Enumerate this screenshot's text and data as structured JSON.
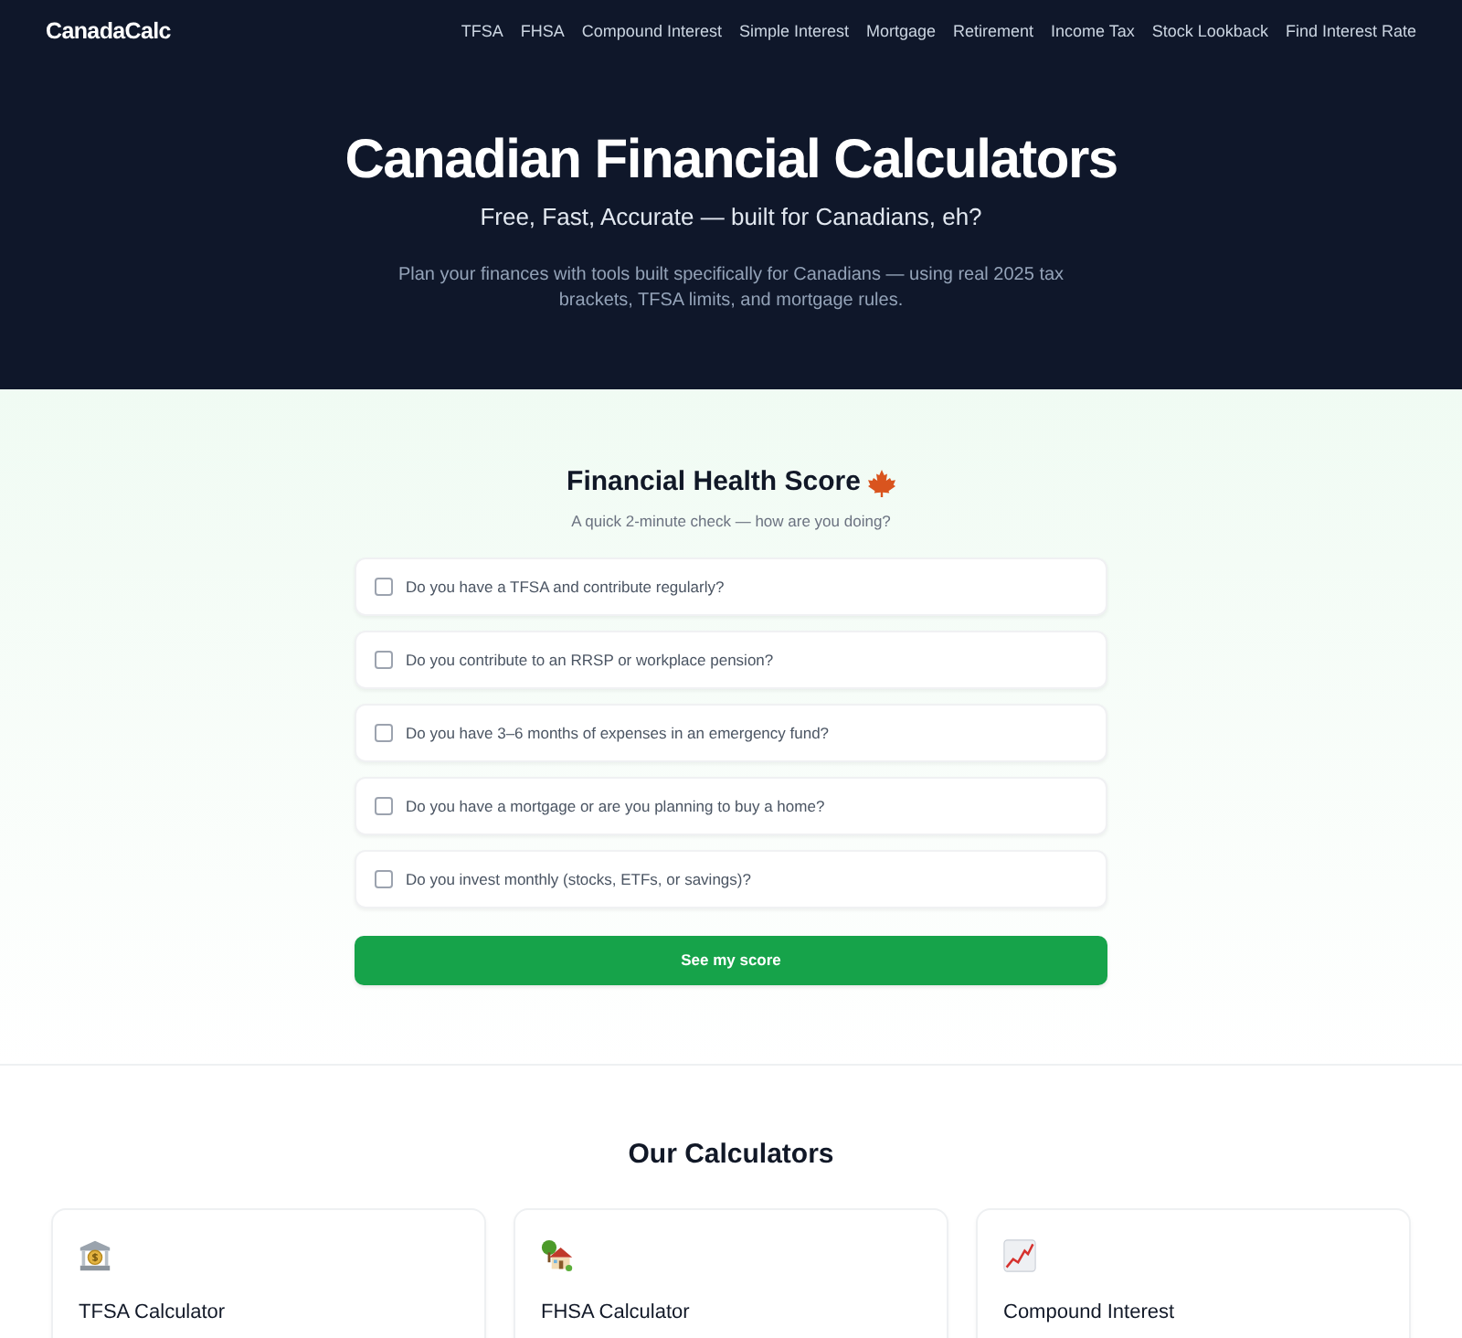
{
  "nav": {
    "logo": "CanadaCalc",
    "links": [
      "TFSA",
      "FHSA",
      "Compound Interest",
      "Simple Interest",
      "Mortgage",
      "Retirement",
      "Income Tax",
      "Stock Lookback",
      "Find Interest Rate"
    ]
  },
  "hero": {
    "title": "Canadian Financial Calculators",
    "tagline": "Free, Fast, Accurate — built for Canadians, eh?",
    "description": "Plan your finances with tools built specifically for Canadians — using real 2025 tax brackets, TFSA limits, and mortgage rules."
  },
  "quiz": {
    "title": "Financial Health Score",
    "subtitle": "A quick 2-minute check — how are you doing?",
    "questions": [
      {
        "text": "Do you have a TFSA and contribute regularly?",
        "checked": false
      },
      {
        "text": "Do you contribute to an RRSP or workplace pension?",
        "checked": false
      },
      {
        "text": "Do you have 3–6 months of expenses in an emergency fund?",
        "checked": false
      },
      {
        "text": "Do you have a mortgage or are you planning to buy a home?",
        "checked": false
      },
      {
        "text": "Do you invest monthly (stocks, ETFs, or savings)?",
        "checked": false
      }
    ],
    "button": "See my score"
  },
  "calculators": {
    "title": "Our Calculators",
    "cards": [
      {
        "kind": "bank",
        "title": "TFSA Calculator"
      },
      {
        "kind": "house",
        "title": "FHSA Calculator"
      },
      {
        "kind": "chart",
        "title": "Compound Interest"
      }
    ]
  }
}
